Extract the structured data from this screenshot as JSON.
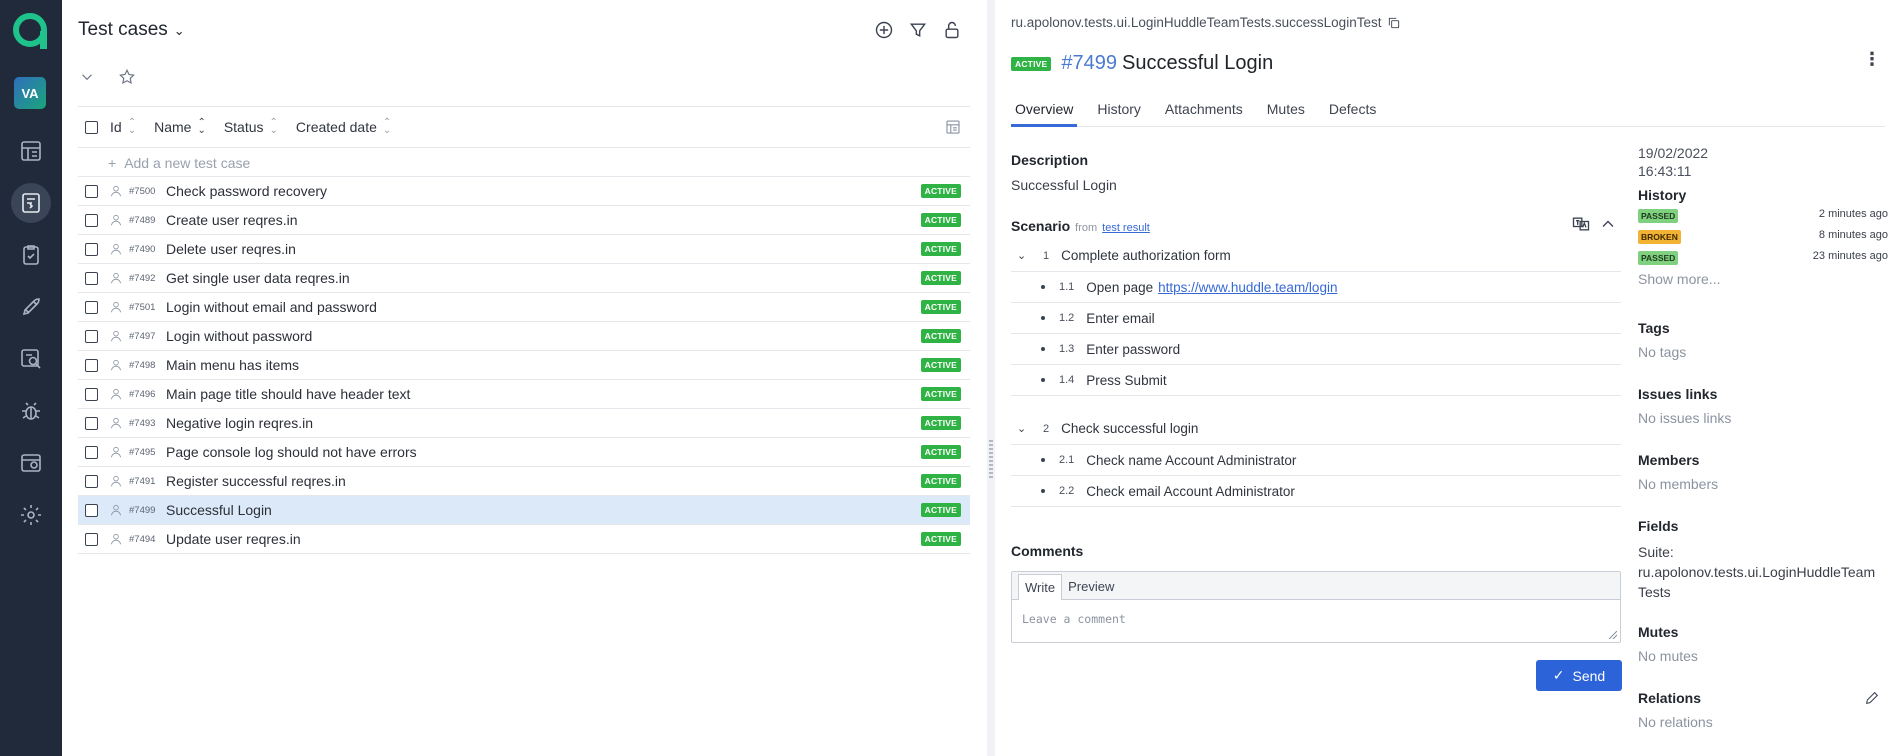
{
  "list": {
    "title": "Test cases",
    "columns": [
      "Id",
      "Name",
      "Status",
      "Created date"
    ],
    "add_label": "Add a new test case",
    "rows": [
      {
        "id": "#7500",
        "name": "Check password recovery",
        "status": "ACTIVE",
        "selected": false
      },
      {
        "id": "#7489",
        "name": "Create user reqres.in",
        "status": "ACTIVE",
        "selected": false
      },
      {
        "id": "#7490",
        "name": "Delete user reqres.in",
        "status": "ACTIVE",
        "selected": false
      },
      {
        "id": "#7492",
        "name": "Get single user data reqres.in",
        "status": "ACTIVE",
        "selected": false
      },
      {
        "id": "#7501",
        "name": "Login without email and password",
        "status": "ACTIVE",
        "selected": false
      },
      {
        "id": "#7497",
        "name": "Login without password",
        "status": "ACTIVE",
        "selected": false
      },
      {
        "id": "#7498",
        "name": "Main menu has items",
        "status": "ACTIVE",
        "selected": false
      },
      {
        "id": "#7496",
        "name": "Main page title should have header text",
        "status": "ACTIVE",
        "selected": false
      },
      {
        "id": "#7493",
        "name": "Negative login reqres.in",
        "status": "ACTIVE",
        "selected": false
      },
      {
        "id": "#7495",
        "name": "Page console log should not have errors",
        "status": "ACTIVE",
        "selected": false
      },
      {
        "id": "#7491",
        "name": "Register successful reqres.in",
        "status": "ACTIVE",
        "selected": false
      },
      {
        "id": "#7499",
        "name": "Successful Login",
        "status": "ACTIVE",
        "selected": true
      },
      {
        "id": "#7494",
        "name": "Update user reqres.in",
        "status": "ACTIVE",
        "selected": false
      }
    ]
  },
  "rail": {
    "avatar": "VA"
  },
  "detail": {
    "fqn": "ru.apolonov.tests.ui.LoginHuddleTeamTests.successLoginTest",
    "status": "ACTIVE",
    "id": "#7499",
    "name": "Successful Login",
    "tabs": [
      "Overview",
      "History",
      "Attachments",
      "Mutes",
      "Defects"
    ],
    "description_label": "Description",
    "description": "Successful Login",
    "scenario_label": "Scenario",
    "scenario_from": "from",
    "scenario_link": "test result",
    "steps": [
      {
        "num": "1",
        "text": "Complete authorization form",
        "sub": [
          {
            "num": "1.1",
            "text": "Open page",
            "link": "https://www.huddle.team/login"
          },
          {
            "num": "1.2",
            "text": "Enter email"
          },
          {
            "num": "1.3",
            "text": "Enter password"
          },
          {
            "num": "1.4",
            "text": "Press Submit"
          }
        ]
      },
      {
        "num": "2",
        "text": "Check successful login",
        "sub": [
          {
            "num": "2.1",
            "text": "Check name Account Administrator"
          },
          {
            "num": "2.2",
            "text": "Check email Account Administrator"
          }
        ]
      }
    ],
    "comments_label": "Comments",
    "write_tab": "Write",
    "preview_tab": "Preview",
    "comment_placeholder": "Leave a comment",
    "send_label": "Send",
    "side": {
      "date": "19/02/2022",
      "time": "16:43:11",
      "history_label": "History",
      "history": [
        {
          "status": "PASSED",
          "ago": "2 minutes ago"
        },
        {
          "status": "BROKEN",
          "ago": "8 minutes ago"
        },
        {
          "status": "PASSED",
          "ago": "23 minutes ago"
        }
      ],
      "show_more": "Show more...",
      "tags_label": "Tags",
      "tags_value": "No tags",
      "issues_label": "Issues links",
      "issues_value": "No issues links",
      "members_label": "Members",
      "members_value": "No members",
      "fields_label": "Fields",
      "fields_suite": "Suite:",
      "fields_suite_value": "ru.apolonov.tests.ui.LoginHuddleTeam",
      "fields_suite_value2": "Tests",
      "mutes_label": "Mutes",
      "mutes_value": "No mutes",
      "relations_label": "Relations",
      "relations_value": "No relations"
    }
  },
  "colors": {
    "rail_bg": "#212a3a",
    "accent": "#2d63d8",
    "active_badge": "#2fb344",
    "selected_row": "#dce9f8"
  }
}
